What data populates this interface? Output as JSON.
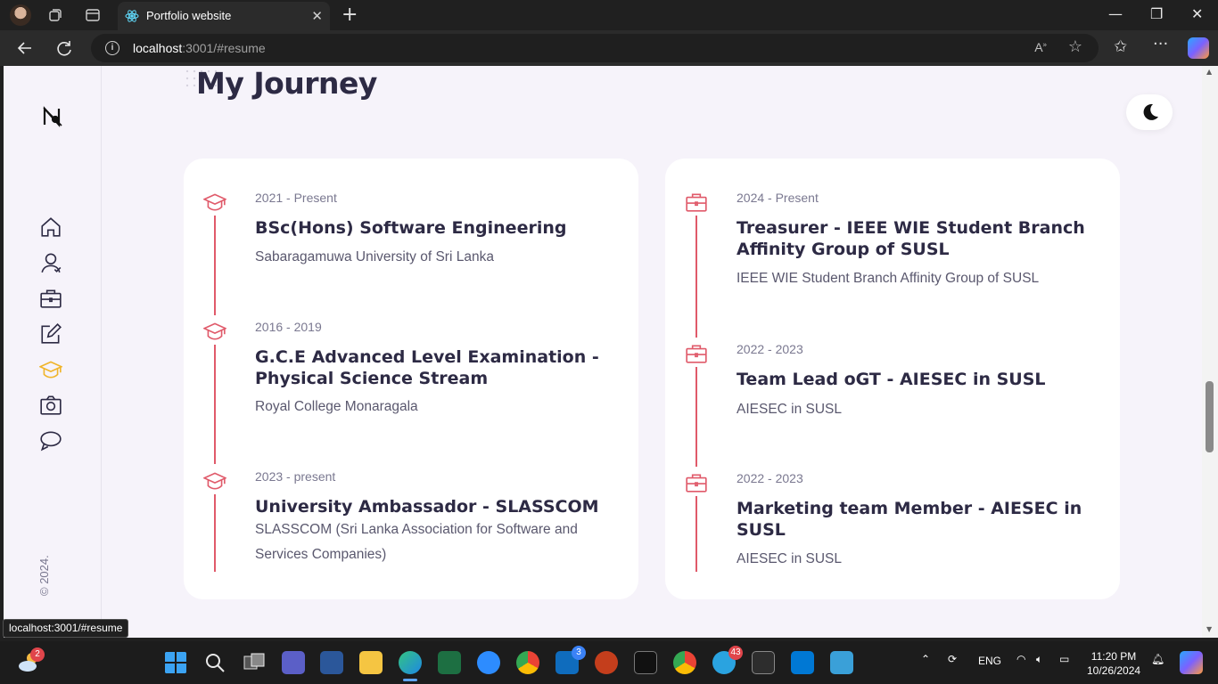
{
  "browser": {
    "tab_title": "Portfolio website",
    "url_host": "localhost",
    "url_rest": ":3001/#resume",
    "status_url": "localhost:3001/#resume"
  },
  "page": {
    "heading": "My Journey",
    "copyright": "© 2024.",
    "theme_toggle_icon": "moon-icon"
  },
  "sidebar": {
    "items": [
      {
        "icon": "home-icon"
      },
      {
        "icon": "user-icon"
      },
      {
        "icon": "briefcase-icon"
      },
      {
        "icon": "edit-icon"
      },
      {
        "icon": "graduation-cap-icon",
        "active": true
      },
      {
        "icon": "camera-icon"
      },
      {
        "icon": "chat-icon"
      }
    ]
  },
  "education": [
    {
      "date": "2021 - Present",
      "title": "BSc(Hons) Software Engineering",
      "org": "Sabaragamuwa University of Sri Lanka"
    },
    {
      "date": "2016 - 2019",
      "title": "G.C.E Advanced Level Examination - Physical Science Stream",
      "org": "Royal College Monaragala"
    },
    {
      "date": "2023 - present",
      "title": "University Ambassador - SLASSCOM",
      "org": "SLASSCOM (Sri Lanka Association for Software and Services Companies)"
    }
  ],
  "experience": [
    {
      "date": "2024 - Present",
      "title": "Treasurer - IEEE WIE Student Branch Affinity Group of SUSL",
      "org": "IEEE WIE Student Branch Affinity Group of SUSL"
    },
    {
      "date": "2022 - 2023",
      "title": "Team Lead oGT - AIESEC in SUSL",
      "org": "AIESEC in SUSL"
    },
    {
      "date": "2022 - 2023",
      "title": "Marketing team Member - AIESEC in SUSL",
      "org": "AIESEC in SUSL"
    }
  ],
  "taskbar": {
    "weather_badge": "2",
    "mail_badge": "3",
    "telegram_badge": "43",
    "language": "ENG",
    "time": "11:20 PM",
    "date": "10/26/2024"
  },
  "colors": {
    "accent": "#e05a6a",
    "active_nav": "#f0b429",
    "text": "#2d2a44"
  }
}
